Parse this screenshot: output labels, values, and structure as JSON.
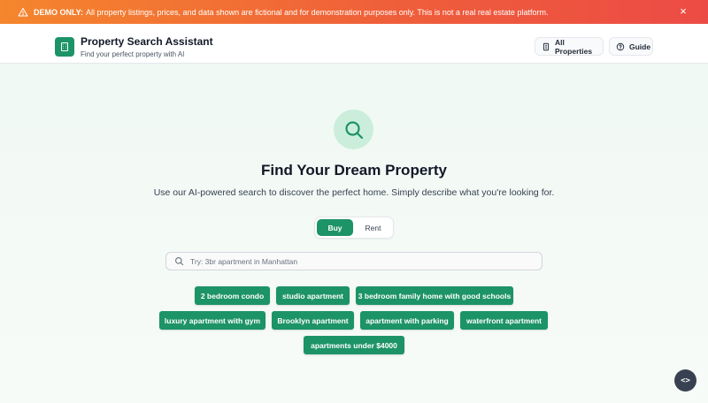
{
  "banner": {
    "label": "DEMO ONLY:",
    "message": "All property listings, prices, and data shown are fictional and for demonstration purposes only. This is not a real real estate platform.",
    "close_symbol": "×",
    "icon": "warning-icon"
  },
  "header": {
    "title": "Property Search Assistant",
    "subtitle": "Find your perfect property with AI",
    "logo_icon": "building-icon",
    "buttons": {
      "all_properties": "All Properties",
      "guide": "Guide"
    }
  },
  "hero": {
    "icon": "search-icon",
    "title": "Find Your Dream Property",
    "subtitle": "Use our AI-powered search to discover the perfect home. Simply describe what you're looking for."
  },
  "toggle": {
    "options": [
      "Buy",
      "Rent"
    ],
    "selected": "Buy"
  },
  "search": {
    "placeholder": "Try: 3br apartment in Manhattan"
  },
  "suggestions": [
    "2 bedroom condo",
    "studio apartment",
    "3 bedroom family home with good schools",
    "luxury apartment with gym",
    "Brooklyn apartment",
    "apartment with parking",
    "waterfront apartment",
    "apartments under $4000"
  ],
  "floating_button": {
    "symbol": "<>",
    "icon": "code-icon"
  },
  "colors": {
    "accent": "#1d9368",
    "banner_start": "#f5862d",
    "banner_end": "#ec4b45",
    "background": "#eef8f2"
  }
}
